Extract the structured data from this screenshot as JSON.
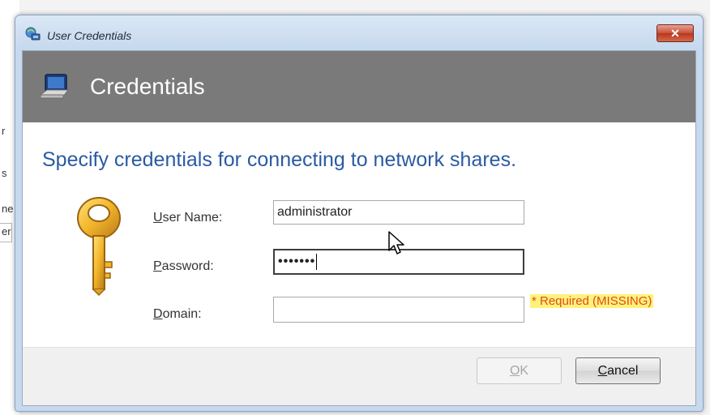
{
  "background": {
    "fragments": [
      "r",
      "s",
      "ne",
      "er"
    ]
  },
  "window": {
    "title": "User Credentials",
    "close_glyph": "✕"
  },
  "banner": {
    "title": "Credentials",
    "icon": "computer-icon"
  },
  "form": {
    "heading": "Specify credentials for connecting to network shares.",
    "key_icon": "key-icon",
    "username": {
      "label_accel": "U",
      "label_rest": "ser Name:",
      "value": "administrator"
    },
    "password": {
      "label_accel": "P",
      "label_rest": "assword:",
      "value": "•••••••"
    },
    "domain": {
      "label_accel": "D",
      "label_rest": "omain:",
      "value": ""
    },
    "required_note": "* Required (MISSING)"
  },
  "buttons": {
    "ok": {
      "accel": "O",
      "rest": "K",
      "enabled": false
    },
    "cancel": {
      "accel": "C",
      "rest": "ancel",
      "enabled": true
    }
  },
  "colors": {
    "heading": "#2a5aa3",
    "banner": "#7a7a7a",
    "required_text": "#e04a1d",
    "required_highlight": "#fff27a"
  }
}
